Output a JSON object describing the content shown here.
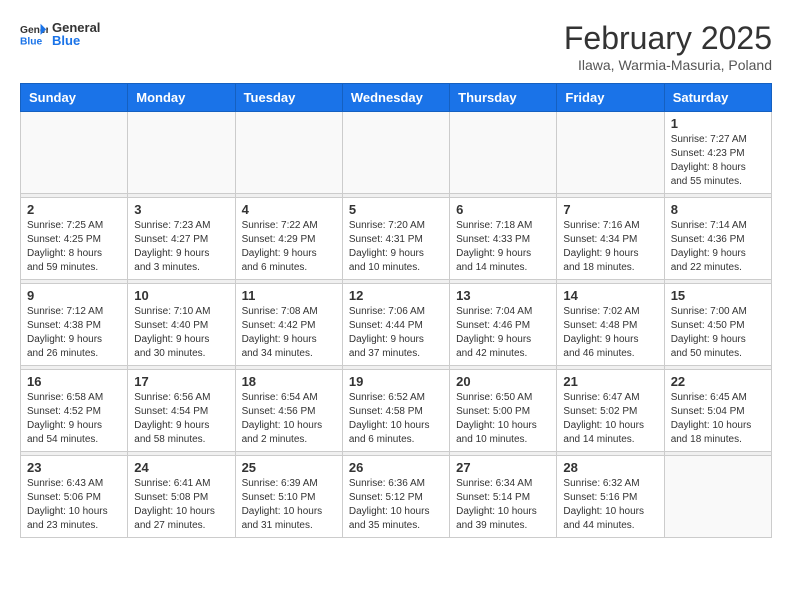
{
  "logo": {
    "general": "General",
    "blue": "Blue"
  },
  "header": {
    "month": "February 2025",
    "location": "Ilawa, Warmia-Masuria, Poland"
  },
  "weekdays": [
    "Sunday",
    "Monday",
    "Tuesday",
    "Wednesday",
    "Thursday",
    "Friday",
    "Saturday"
  ],
  "weeks": [
    [
      {
        "day": "",
        "info": ""
      },
      {
        "day": "",
        "info": ""
      },
      {
        "day": "",
        "info": ""
      },
      {
        "day": "",
        "info": ""
      },
      {
        "day": "",
        "info": ""
      },
      {
        "day": "",
        "info": ""
      },
      {
        "day": "1",
        "info": "Sunrise: 7:27 AM\nSunset: 4:23 PM\nDaylight: 8 hours and 55 minutes."
      }
    ],
    [
      {
        "day": "2",
        "info": "Sunrise: 7:25 AM\nSunset: 4:25 PM\nDaylight: 8 hours and 59 minutes."
      },
      {
        "day": "3",
        "info": "Sunrise: 7:23 AM\nSunset: 4:27 PM\nDaylight: 9 hours and 3 minutes."
      },
      {
        "day": "4",
        "info": "Sunrise: 7:22 AM\nSunset: 4:29 PM\nDaylight: 9 hours and 6 minutes."
      },
      {
        "day": "5",
        "info": "Sunrise: 7:20 AM\nSunset: 4:31 PM\nDaylight: 9 hours and 10 minutes."
      },
      {
        "day": "6",
        "info": "Sunrise: 7:18 AM\nSunset: 4:33 PM\nDaylight: 9 hours and 14 minutes."
      },
      {
        "day": "7",
        "info": "Sunrise: 7:16 AM\nSunset: 4:34 PM\nDaylight: 9 hours and 18 minutes."
      },
      {
        "day": "8",
        "info": "Sunrise: 7:14 AM\nSunset: 4:36 PM\nDaylight: 9 hours and 22 minutes."
      }
    ],
    [
      {
        "day": "9",
        "info": "Sunrise: 7:12 AM\nSunset: 4:38 PM\nDaylight: 9 hours and 26 minutes."
      },
      {
        "day": "10",
        "info": "Sunrise: 7:10 AM\nSunset: 4:40 PM\nDaylight: 9 hours and 30 minutes."
      },
      {
        "day": "11",
        "info": "Sunrise: 7:08 AM\nSunset: 4:42 PM\nDaylight: 9 hours and 34 minutes."
      },
      {
        "day": "12",
        "info": "Sunrise: 7:06 AM\nSunset: 4:44 PM\nDaylight: 9 hours and 37 minutes."
      },
      {
        "day": "13",
        "info": "Sunrise: 7:04 AM\nSunset: 4:46 PM\nDaylight: 9 hours and 42 minutes."
      },
      {
        "day": "14",
        "info": "Sunrise: 7:02 AM\nSunset: 4:48 PM\nDaylight: 9 hours and 46 minutes."
      },
      {
        "day": "15",
        "info": "Sunrise: 7:00 AM\nSunset: 4:50 PM\nDaylight: 9 hours and 50 minutes."
      }
    ],
    [
      {
        "day": "16",
        "info": "Sunrise: 6:58 AM\nSunset: 4:52 PM\nDaylight: 9 hours and 54 minutes."
      },
      {
        "day": "17",
        "info": "Sunrise: 6:56 AM\nSunset: 4:54 PM\nDaylight: 9 hours and 58 minutes."
      },
      {
        "day": "18",
        "info": "Sunrise: 6:54 AM\nSunset: 4:56 PM\nDaylight: 10 hours and 2 minutes."
      },
      {
        "day": "19",
        "info": "Sunrise: 6:52 AM\nSunset: 4:58 PM\nDaylight: 10 hours and 6 minutes."
      },
      {
        "day": "20",
        "info": "Sunrise: 6:50 AM\nSunset: 5:00 PM\nDaylight: 10 hours and 10 minutes."
      },
      {
        "day": "21",
        "info": "Sunrise: 6:47 AM\nSunset: 5:02 PM\nDaylight: 10 hours and 14 minutes."
      },
      {
        "day": "22",
        "info": "Sunrise: 6:45 AM\nSunset: 5:04 PM\nDaylight: 10 hours and 18 minutes."
      }
    ],
    [
      {
        "day": "23",
        "info": "Sunrise: 6:43 AM\nSunset: 5:06 PM\nDaylight: 10 hours and 23 minutes."
      },
      {
        "day": "24",
        "info": "Sunrise: 6:41 AM\nSunset: 5:08 PM\nDaylight: 10 hours and 27 minutes."
      },
      {
        "day": "25",
        "info": "Sunrise: 6:39 AM\nSunset: 5:10 PM\nDaylight: 10 hours and 31 minutes."
      },
      {
        "day": "26",
        "info": "Sunrise: 6:36 AM\nSunset: 5:12 PM\nDaylight: 10 hours and 35 minutes."
      },
      {
        "day": "27",
        "info": "Sunrise: 6:34 AM\nSunset: 5:14 PM\nDaylight: 10 hours and 39 minutes."
      },
      {
        "day": "28",
        "info": "Sunrise: 6:32 AM\nSunset: 5:16 PM\nDaylight: 10 hours and 44 minutes."
      },
      {
        "day": "",
        "info": ""
      }
    ]
  ]
}
